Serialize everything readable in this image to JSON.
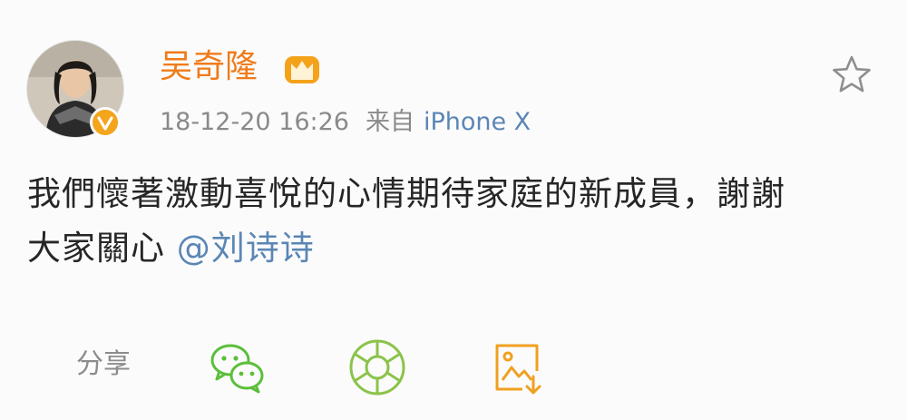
{
  "post": {
    "author": "吴奇隆",
    "timestamp": "18-12-20 16:26",
    "source_label": "来自",
    "source_device": "iPhone X",
    "content_line1": "我們懷著激動喜悅的心情期待家庭的新成員，謝謝",
    "content_line2": "大家關心 ",
    "mention": "@刘诗诗"
  },
  "share": {
    "label": "分享"
  },
  "icons": {
    "favorite": "star-icon",
    "vip": "crown-icon",
    "verified": "verified-badge-icon",
    "wechat": "wechat-icon",
    "moments": "moments-icon",
    "save": "save-image-icon"
  },
  "colors": {
    "author": "#f07b19",
    "link": "#5b86b5",
    "meta": "#8a8a8a",
    "text": "#262626",
    "wechat": "#5bbf3a",
    "moments": "#8bc34a",
    "save": "#f0a020"
  }
}
